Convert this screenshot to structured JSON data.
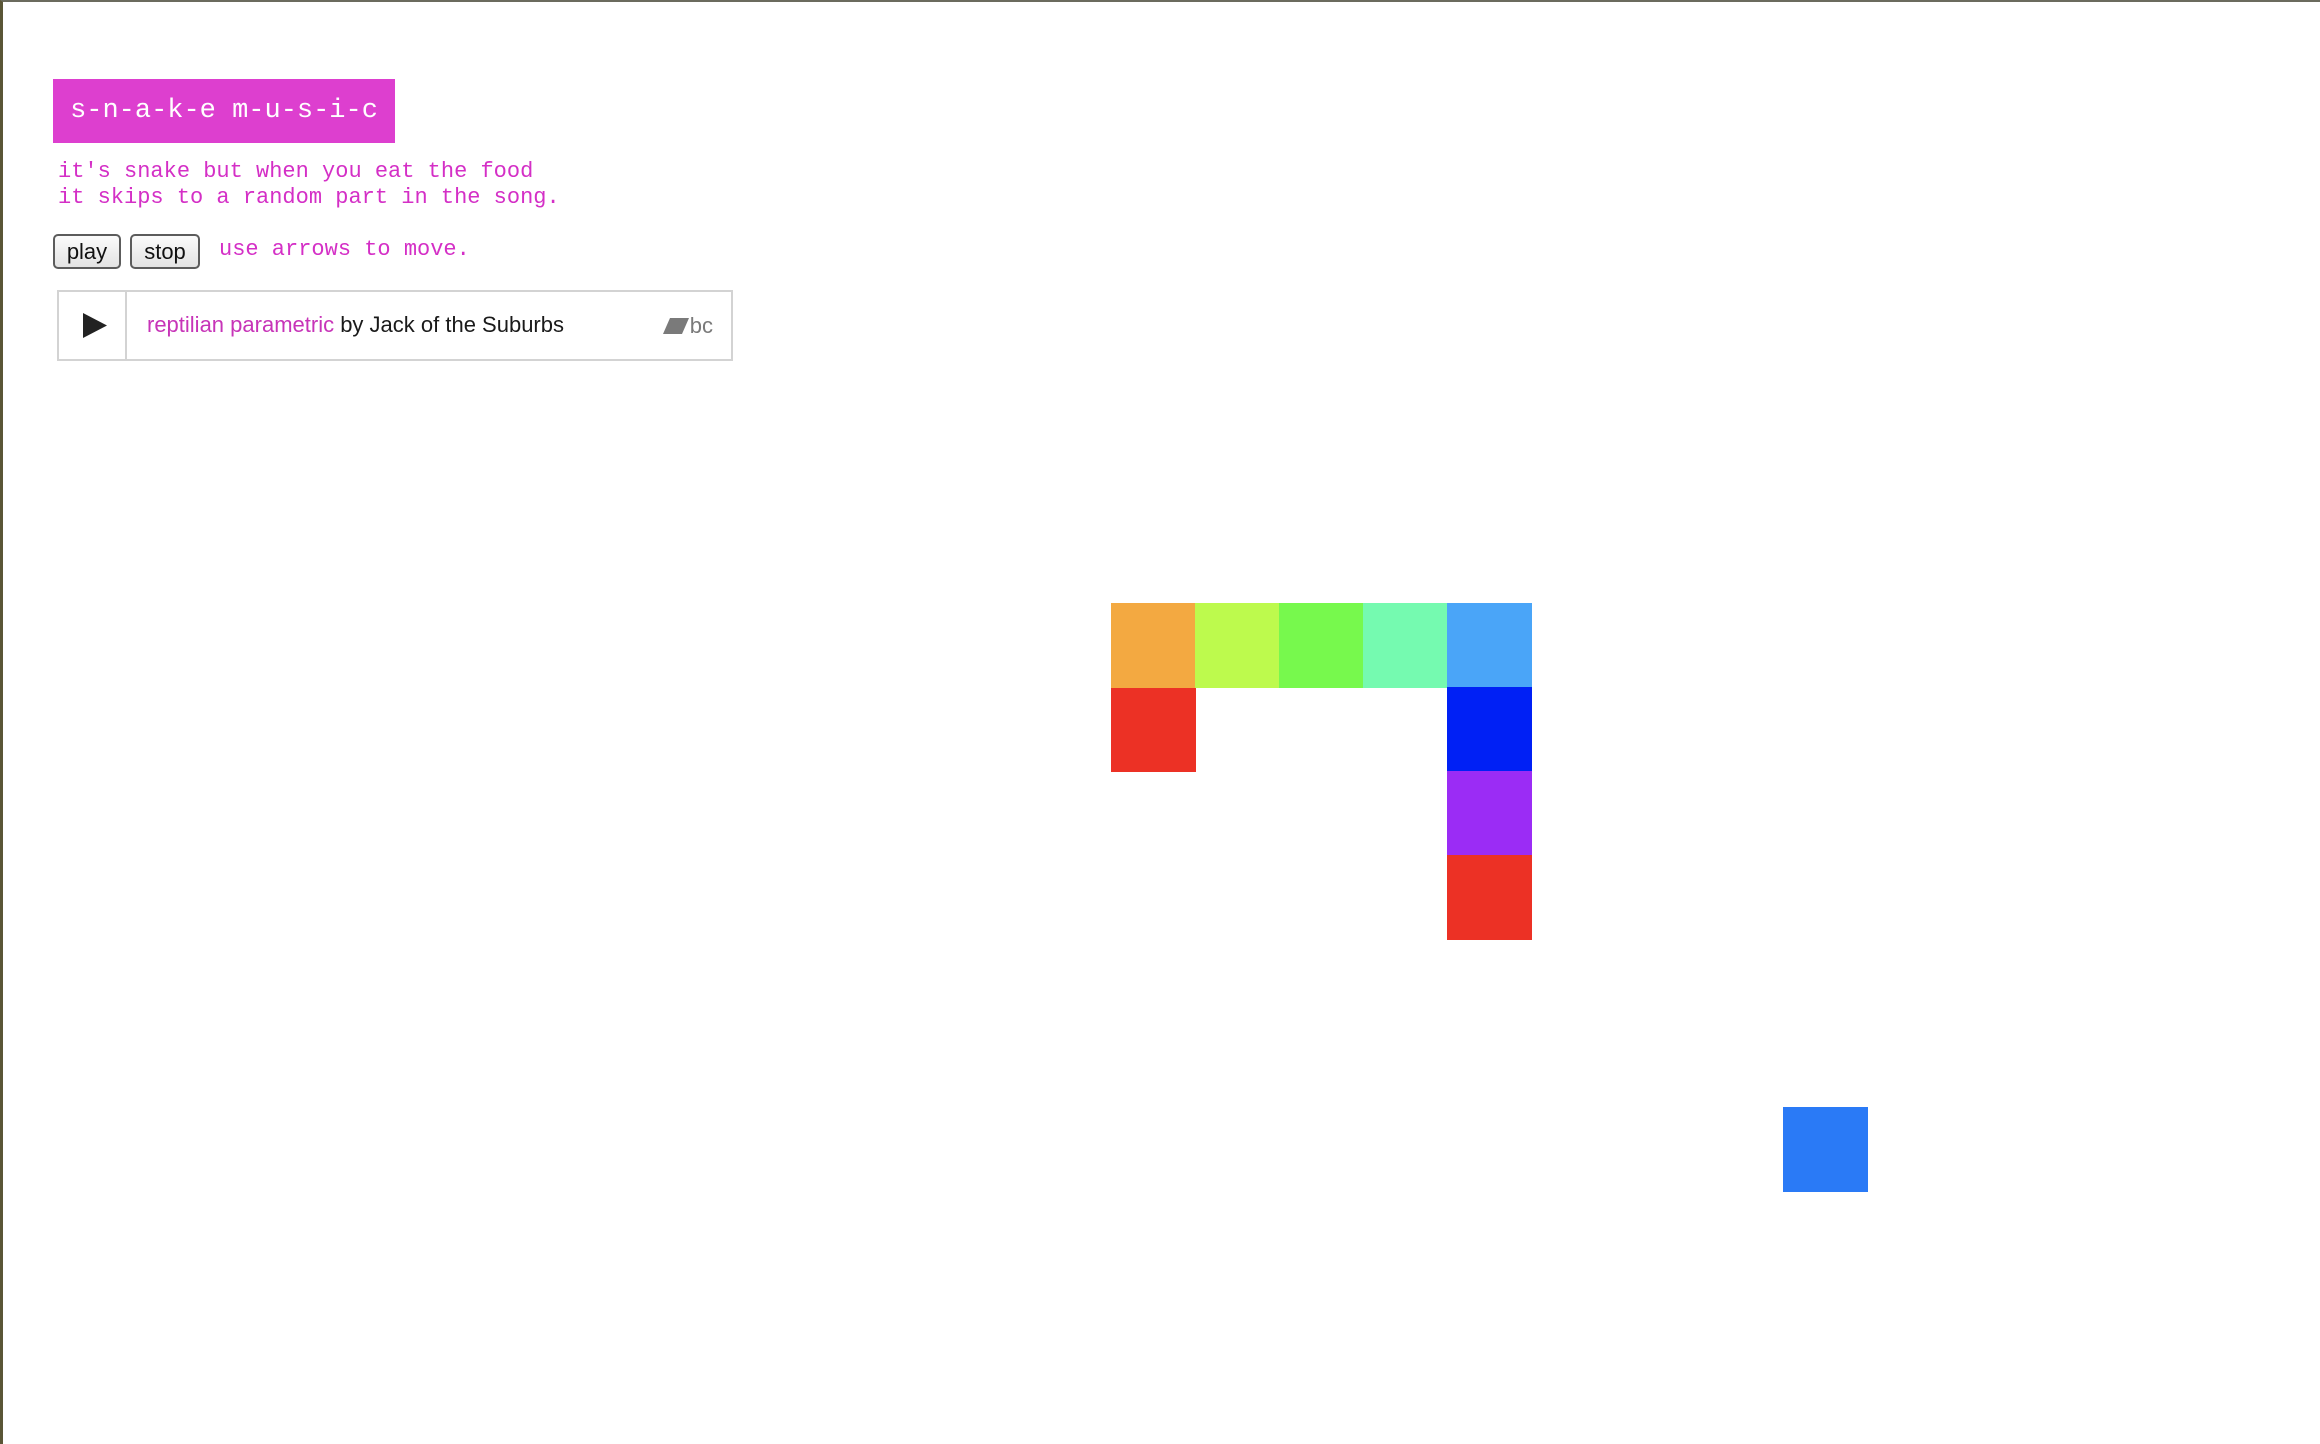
{
  "header": {
    "title": "s-n-a-k-e m-u-s-i-c",
    "description_line1": "it's snake but when you eat the food",
    "description_line2": "it skips to a random part in the song."
  },
  "controls": {
    "play_label": "play",
    "stop_label": "stop",
    "hint": "use arrows to move."
  },
  "player": {
    "track_name": "reptilian parametric",
    "by_text": " by ",
    "artist": "Jack of the Suburbs",
    "logo_text": "bc",
    "play_icon": "play-triangle-icon",
    "logo_icon": "bandcamp-logo-icon"
  },
  "colors": {
    "title_bg": "#dd3fcf",
    "accent_text": "#d42fc6"
  },
  "game": {
    "grid_cell": "snake-body-segment",
    "snake_segments": [
      {
        "col": 0,
        "row": 1,
        "color": "#ec3125"
      },
      {
        "col": 0,
        "row": 0,
        "color": "#f3a941"
      },
      {
        "col": 1,
        "row": 0,
        "color": "#bdfa4d"
      },
      {
        "col": 2,
        "row": 0,
        "color": "#77f94d"
      },
      {
        "col": 3,
        "row": 0,
        "color": "#75fab0"
      },
      {
        "col": 4,
        "row": 0,
        "color": "#4aa5f8"
      },
      {
        "col": 4,
        "row": 1,
        "color": "#0020f5"
      },
      {
        "col": 4,
        "row": 2,
        "color": "#9b2cf5"
      },
      {
        "col": 4,
        "row": 3,
        "color": "#ec3125"
      }
    ],
    "food": {
      "col": 8,
      "row": 6,
      "color": "#2a7af6"
    }
  }
}
